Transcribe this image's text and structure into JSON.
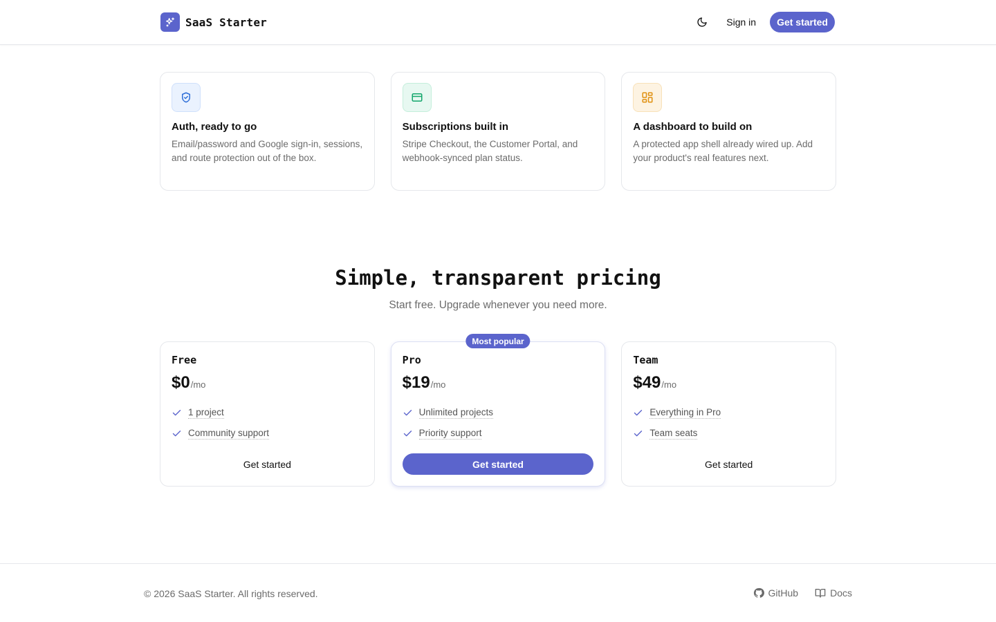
{
  "colors": {
    "accent": "#5b64cc",
    "text": "#111111",
    "muted": "#6b6b6b",
    "border": "#e5e7eb"
  },
  "header": {
    "brand": "SaaS Starter",
    "brand_icon": "sparkles-icon",
    "theme_icon": "moon-icon",
    "signin_label": "Sign in",
    "cta_label": "Get started"
  },
  "features": [
    {
      "icon": "shield-check-icon",
      "title": "Auth, ready to go",
      "desc": "Email/password and Google sign-in, sessions, and route protection out of the box."
    },
    {
      "icon": "credit-card-icon",
      "title": "Subscriptions built in",
      "desc": "Stripe Checkout, the Customer Portal, and webhook-synced plan status."
    },
    {
      "icon": "layout-dashboard-icon",
      "title": "A dashboard to build on",
      "desc": "A protected app shell already wired up. Add your product's real features next."
    }
  ],
  "pricing": {
    "title": "Simple, transparent pricing",
    "subtitle": "Start free. Upgrade whenever you need more.",
    "plans": [
      {
        "name": "Free",
        "price": "$0",
        "period": "/mo",
        "features": [
          "1 project",
          "Community support"
        ],
        "cta": "Get started"
      },
      {
        "name": "Pro",
        "badge": "Most popular",
        "price": "$19",
        "period": "/mo",
        "features": [
          "Unlimited projects",
          "Priority support"
        ],
        "cta": "Get started"
      },
      {
        "name": "Team",
        "price": "$49",
        "period": "/mo",
        "features": [
          "Everything in Pro",
          "Team seats"
        ],
        "cta": "Get started"
      }
    ]
  },
  "footer": {
    "copyright": "© 2026 SaaS Starter. All rights reserved.",
    "github_label": "GitHub",
    "docs_label": "Docs"
  }
}
